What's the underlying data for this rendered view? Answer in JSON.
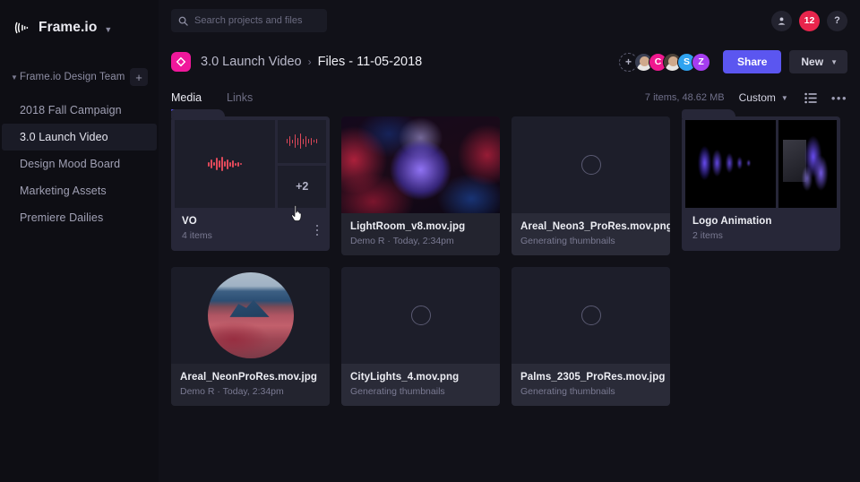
{
  "brand": {
    "name": "Frame.io",
    "caret": "chevron-down"
  },
  "sidebar": {
    "team": {
      "label": "Frame.io Design Team",
      "add_label": "+"
    },
    "projects": [
      {
        "label": "2018 Fall Campaign",
        "active": false
      },
      {
        "label": "3.0 Launch Video",
        "active": true
      },
      {
        "label": "Design Mood Board",
        "active": false
      },
      {
        "label": "Marketing Assets",
        "active": false
      },
      {
        "label": "Premiere Dailies",
        "active": false
      }
    ]
  },
  "topbar": {
    "search_placeholder": "Search projects and files",
    "account_icon": "person-icon",
    "notification_count": "12",
    "help_label": "?"
  },
  "breadcrumb": {
    "project": "3.0 Launch Video",
    "separator": "›",
    "current": "Files - 11-05-2018"
  },
  "collaborators": {
    "add_label": "+",
    "avatars": [
      {
        "type": "photo",
        "label": ""
      },
      {
        "type": "initial",
        "label": "C",
        "color": "#f0198f"
      },
      {
        "type": "photo",
        "label": ""
      },
      {
        "type": "initial",
        "label": "S",
        "color": "#2fa3f0"
      },
      {
        "type": "initial",
        "label": "Z",
        "color": "#a53df0"
      }
    ]
  },
  "actions": {
    "share_label": "Share",
    "share_color": "#5b56f0",
    "new_label": "New",
    "new_caret": "chevron-down"
  },
  "tabs": [
    {
      "label": "Media",
      "active": true
    },
    {
      "label": "Links",
      "active": false
    }
  ],
  "toolbar": {
    "item_count": "7 items, 48.62 MB",
    "sort_label": "Custom",
    "sort_caret": "chevron-down",
    "view_icon": "list-view-icon",
    "more_icon": "more-horizontal-icon"
  },
  "files": [
    {
      "name": "VO",
      "sub": "4 items",
      "kind": "folder",
      "overflow": "+2",
      "has_kebab": true
    },
    {
      "name": "LightRoom_v8.mov.jpg",
      "sub": "Demo R · Today, 2:34pm",
      "kind": "image"
    },
    {
      "name": "Areal_Neon3_ProRes.mov.png",
      "sub": "Generating thumbnails",
      "kind": "loading"
    },
    {
      "name": "Logo Animation",
      "sub": "2 items",
      "kind": "folder-images"
    },
    {
      "name": "Areal_NeonProRes.mov.jpg",
      "sub": "Demo R · Today, 2:34pm",
      "kind": "image-areal"
    },
    {
      "name": "CityLights_4.mov.png",
      "sub": "Generating thumbnails",
      "kind": "loading"
    },
    {
      "name": "Palms_2305_ProRes.mov.jpg",
      "sub": "Generating thumbnails",
      "kind": "loading"
    }
  ]
}
